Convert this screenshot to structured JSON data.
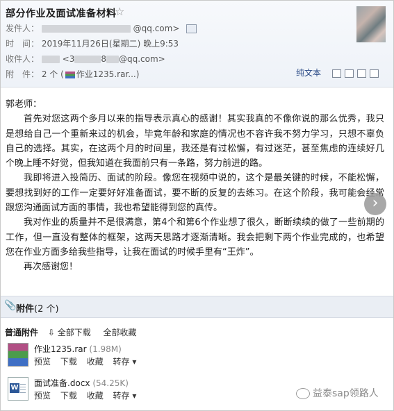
{
  "header": {
    "subject": "部分作业及面试准备材料",
    "star": "☆",
    "from_label": "发件人：",
    "from_value": "@qq.com>",
    "time_label": "时　间：",
    "time_value": "2019年11月26日(星期二) 晚上9:53",
    "to_label": "收件人：",
    "to_value_prefix": "<3",
    "to_value_mid": "8",
    "to_value_suffix": "@qq.com>",
    "attach_label": "附　件：",
    "attach_count": "2 个 (",
    "attach_name": "作业1235.rar...)",
    "plain_text": "纯文本"
  },
  "letter": {
    "salutation": "郭老师：",
    "p1": "首先对您这两个多月以来的指导表示真心的感谢！其实我真的不像你说的那么优秀，我只是想给自己一个重新来过的机会，毕竟年龄和家庭的情况也不容许我不努力学习，只想不辜负自己的选择。其实，在这两个月的时间里，我还是有过松懈，有过迷茫，甚至焦虑的连续好几个晚上睡不好觉，但我知道在我面前只有一条路，努力前进的路。",
    "p2": "我即将进入投简历、面试的阶段。像您在视频中说的，这个是最关键的时候，不能松懈，要想找到好的工作一定要好好准备面试，要不断的反复的去练习。在这个阶段，我可能会经常跟您沟通面试方面的事情，我也希望能得到您的真传。",
    "p3": "我对作业的质量并不是很满意，第4个和第6个作业想了很久，断断续续的做了一些前期的工作，但一直没有整体的框架，这两天思路才逐渐清晰。我会把剩下两个作业完成的，也希望您在作业方面多给我些指导，让我在面试的时候手里有“王炸”。",
    "p4": "再次感谢您！",
    "nav_arrow": "›"
  },
  "attachments": {
    "title": "附件",
    "count": "(2 个)",
    "section_title": "普通附件",
    "download_all": "⇩ 全部下载",
    "save_all": "全部收藏",
    "files": [
      {
        "name": "作业1235.rar",
        "size": "(1.98M)",
        "icon": "rar-icon",
        "actions": [
          "预览",
          "下载",
          "收藏",
          "转存 ▾"
        ]
      },
      {
        "name": "面试准备.docx",
        "size": "(54.25K)",
        "icon": "word-doc-icon",
        "actions": [
          "预览",
          "下载",
          "收藏",
          "转存 ▾"
        ]
      }
    ]
  },
  "watermark": "益泰sap领路人"
}
